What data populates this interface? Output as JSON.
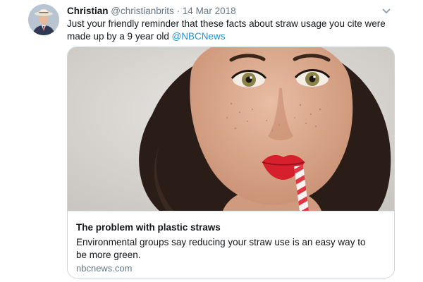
{
  "tweet": {
    "author_name": "Christian",
    "author_handle": "@christianbrits",
    "separator": "·",
    "date": "14 Mar 2018",
    "text_line1": "Just your friendly reminder that these facts about straw usage you cite were",
    "text_line2_prefix": "made up by a 9 year old ",
    "mention": "@NBCNews",
    "avatar_icon": "user-avatar",
    "menu_icon": "chevron-down-icon"
  },
  "card": {
    "image_icon": "photo-woman-drinking-through-red-white-straw",
    "title": "The problem with plastic straws",
    "description": "Environmental groups say reducing your straw use is an easy way to be more green.",
    "domain": "nbcnews.com"
  },
  "colors": {
    "link": "#1b95e0",
    "secondary_text": "#657786",
    "border": "#ccd6dd",
    "lipstick": "#d61f2c"
  }
}
